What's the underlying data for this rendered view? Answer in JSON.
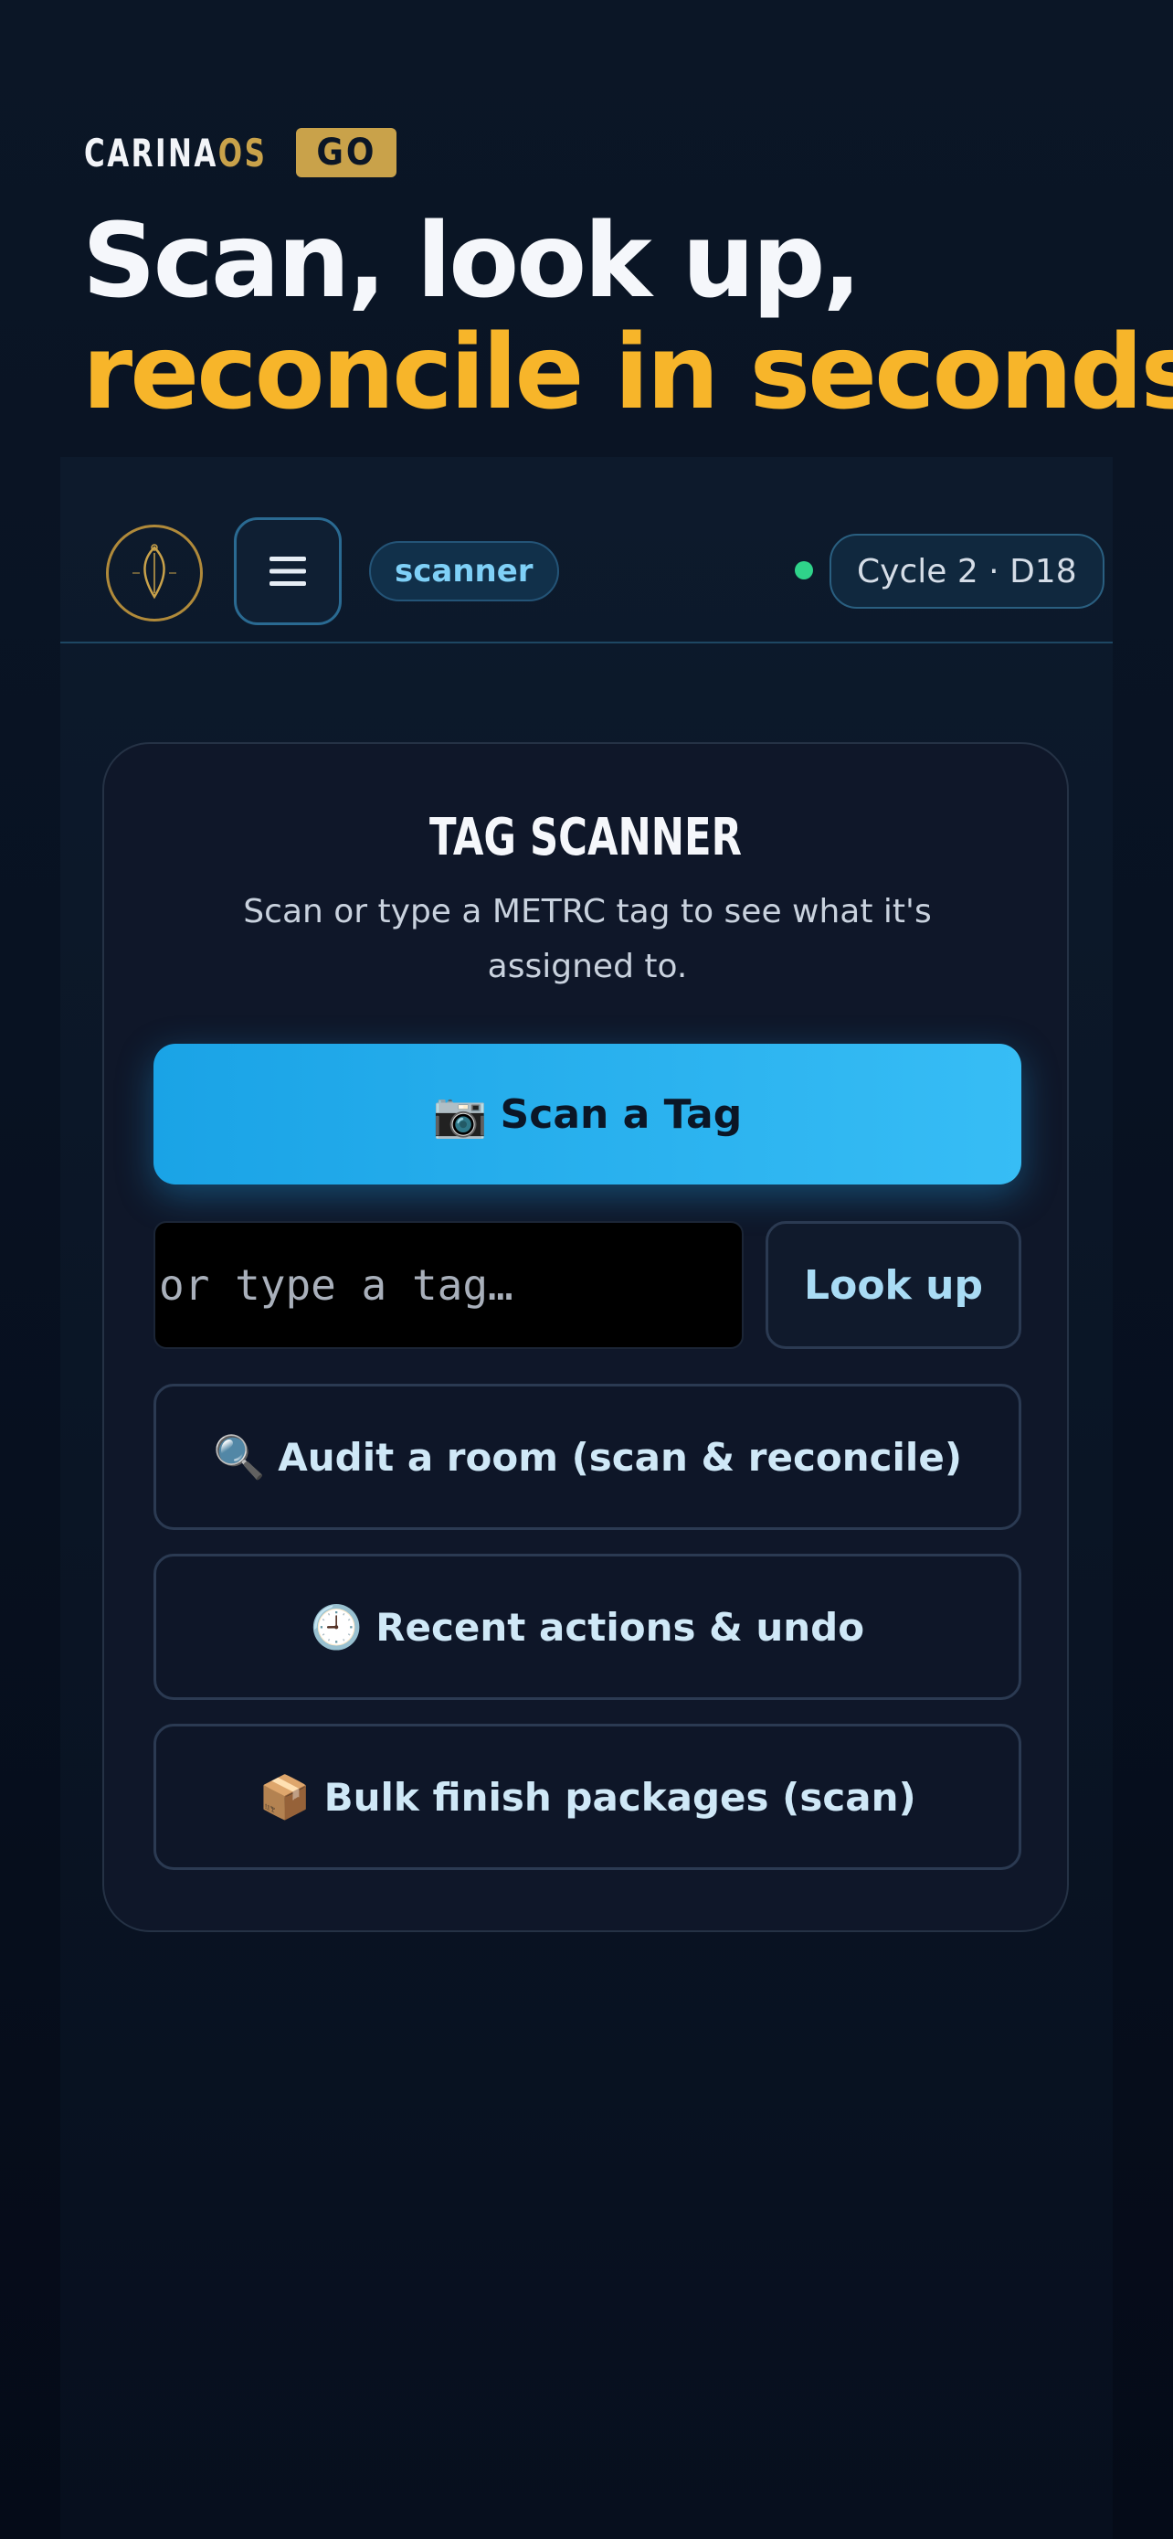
{
  "brand": {
    "name_primary": "CARINA",
    "name_accent": "OS",
    "badge": "GO"
  },
  "hero": {
    "line1": "Scan, look up,",
    "line2": "reconcile in seconds"
  },
  "colors": {
    "accent_gold": "#f7b52a",
    "brand_gold": "#c9a24a",
    "primary_blue": "#1aa3e6",
    "status_green": "#2fd38a",
    "background": "#081222"
  },
  "app_header": {
    "logo_icon": "leaf-logo-icon",
    "menu_icon": "hamburger-menu-icon",
    "route_badge": "scanner",
    "status": "online",
    "cycle_label": "Cycle 2 · D18"
  },
  "scanner_card": {
    "title": "TAG SCANNER",
    "subtitle": "Scan or type a METRC tag to see what it's assigned to.",
    "scan_button": {
      "emoji": "📷",
      "label": "Scan a Tag"
    },
    "tag_input": {
      "value": "",
      "placeholder": "or type a tag…"
    },
    "lookup_button": "Look up",
    "actions": [
      {
        "emoji": "🔍",
        "label": "Audit a room (scan & reconcile)"
      },
      {
        "emoji": "🕘",
        "label": "Recent actions & undo"
      },
      {
        "emoji": "📦",
        "label": "Bulk finish packages (scan)"
      }
    ]
  }
}
